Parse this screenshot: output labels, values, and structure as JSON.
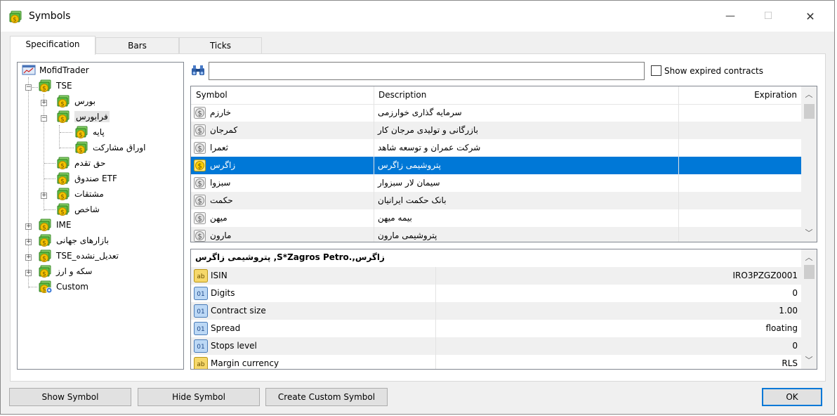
{
  "window": {
    "title": "Symbols",
    "minimize": "—",
    "maximize": "☐",
    "close": "✕"
  },
  "tabs": [
    {
      "label": "Specification",
      "active": true
    },
    {
      "label": "Bars",
      "active": false
    },
    {
      "label": "Ticks",
      "active": false
    }
  ],
  "tree": {
    "root": "MofidTrader",
    "nodes": [
      {
        "label": "TSE"
      },
      {
        "label": "بورس"
      },
      {
        "label": "فرابورس"
      },
      {
        "label": "پایه"
      },
      {
        "label": "اوراق مشارکت"
      },
      {
        "label": "حق تقدم"
      },
      {
        "label": "صندوق ETF"
      },
      {
        "label": "مشتقات"
      },
      {
        "label": "شاخص"
      },
      {
        "label": "IME"
      },
      {
        "label": "بازارهای جهانی"
      },
      {
        "label": "TSE_تعدیل_نشده"
      },
      {
        "label": "سکه و ارز"
      },
      {
        "label": "Custom"
      }
    ]
  },
  "search": {
    "value": "",
    "placeholder": ""
  },
  "show_expired": {
    "label": "Show expired contracts",
    "checked": false
  },
  "grid": {
    "columns": {
      "symbol": "Symbol",
      "description": "Description",
      "expiration": "Expiration"
    },
    "rows": [
      {
        "symbol": "خارزم",
        "description": "سرمایه گذاری خوارزمی",
        "expiration": "",
        "selected": false
      },
      {
        "symbol": "کمرجان",
        "description": "بازرگانی و تولیدی مرجان کار",
        "expiration": "",
        "selected": false
      },
      {
        "symbol": "ثعمرا",
        "description": "شرکت عمران و توسعه شاهد",
        "expiration": "",
        "selected": false
      },
      {
        "symbol": "زاگرس",
        "description": "پتروشیمی زاگرس",
        "expiration": "",
        "selected": true
      },
      {
        "symbol": "سبزوا",
        "description": "سیمان لار سبزوار",
        "expiration": "",
        "selected": false
      },
      {
        "symbol": "حکمت",
        "description": "بانک حکمت  ایرانیان",
        "expiration": "",
        "selected": false
      },
      {
        "symbol": "میهن",
        "description": "بیمه میهن",
        "expiration": "",
        "selected": false
      },
      {
        "symbol": "مارون",
        "description": "پتروشیمی مارون",
        "expiration": "",
        "selected": false
      }
    ]
  },
  "properties": {
    "title": "پتروشیمی زاگرس ,S*Zagros Petro.,زاگرس",
    "rows": [
      {
        "name": "ISIN",
        "value": "IRO3PZGZ0001",
        "icon": "text-property-icon"
      },
      {
        "name": "Digits",
        "value": "0",
        "icon": "numeric-property-icon"
      },
      {
        "name": "Contract size",
        "value": "1.00",
        "icon": "numeric-property-icon"
      },
      {
        "name": "Spread",
        "value": "floating",
        "icon": "numeric-property-icon"
      },
      {
        "name": "Stops level",
        "value": "0",
        "icon": "numeric-property-icon"
      },
      {
        "name": "Margin currency",
        "value": "RLS",
        "icon": "text-property-icon"
      }
    ]
  },
  "buttons": {
    "show_symbol": "Show Symbol",
    "hide_symbol": "Hide Symbol",
    "create_custom": "Create Custom Symbol",
    "ok": "OK"
  },
  "icon_text": {
    "text_icon": "ab",
    "num_icon": "01"
  },
  "colors": {
    "selection": "#0078d7",
    "folder_green": "#3a9a3a",
    "coin_gold": "#e6b800"
  }
}
